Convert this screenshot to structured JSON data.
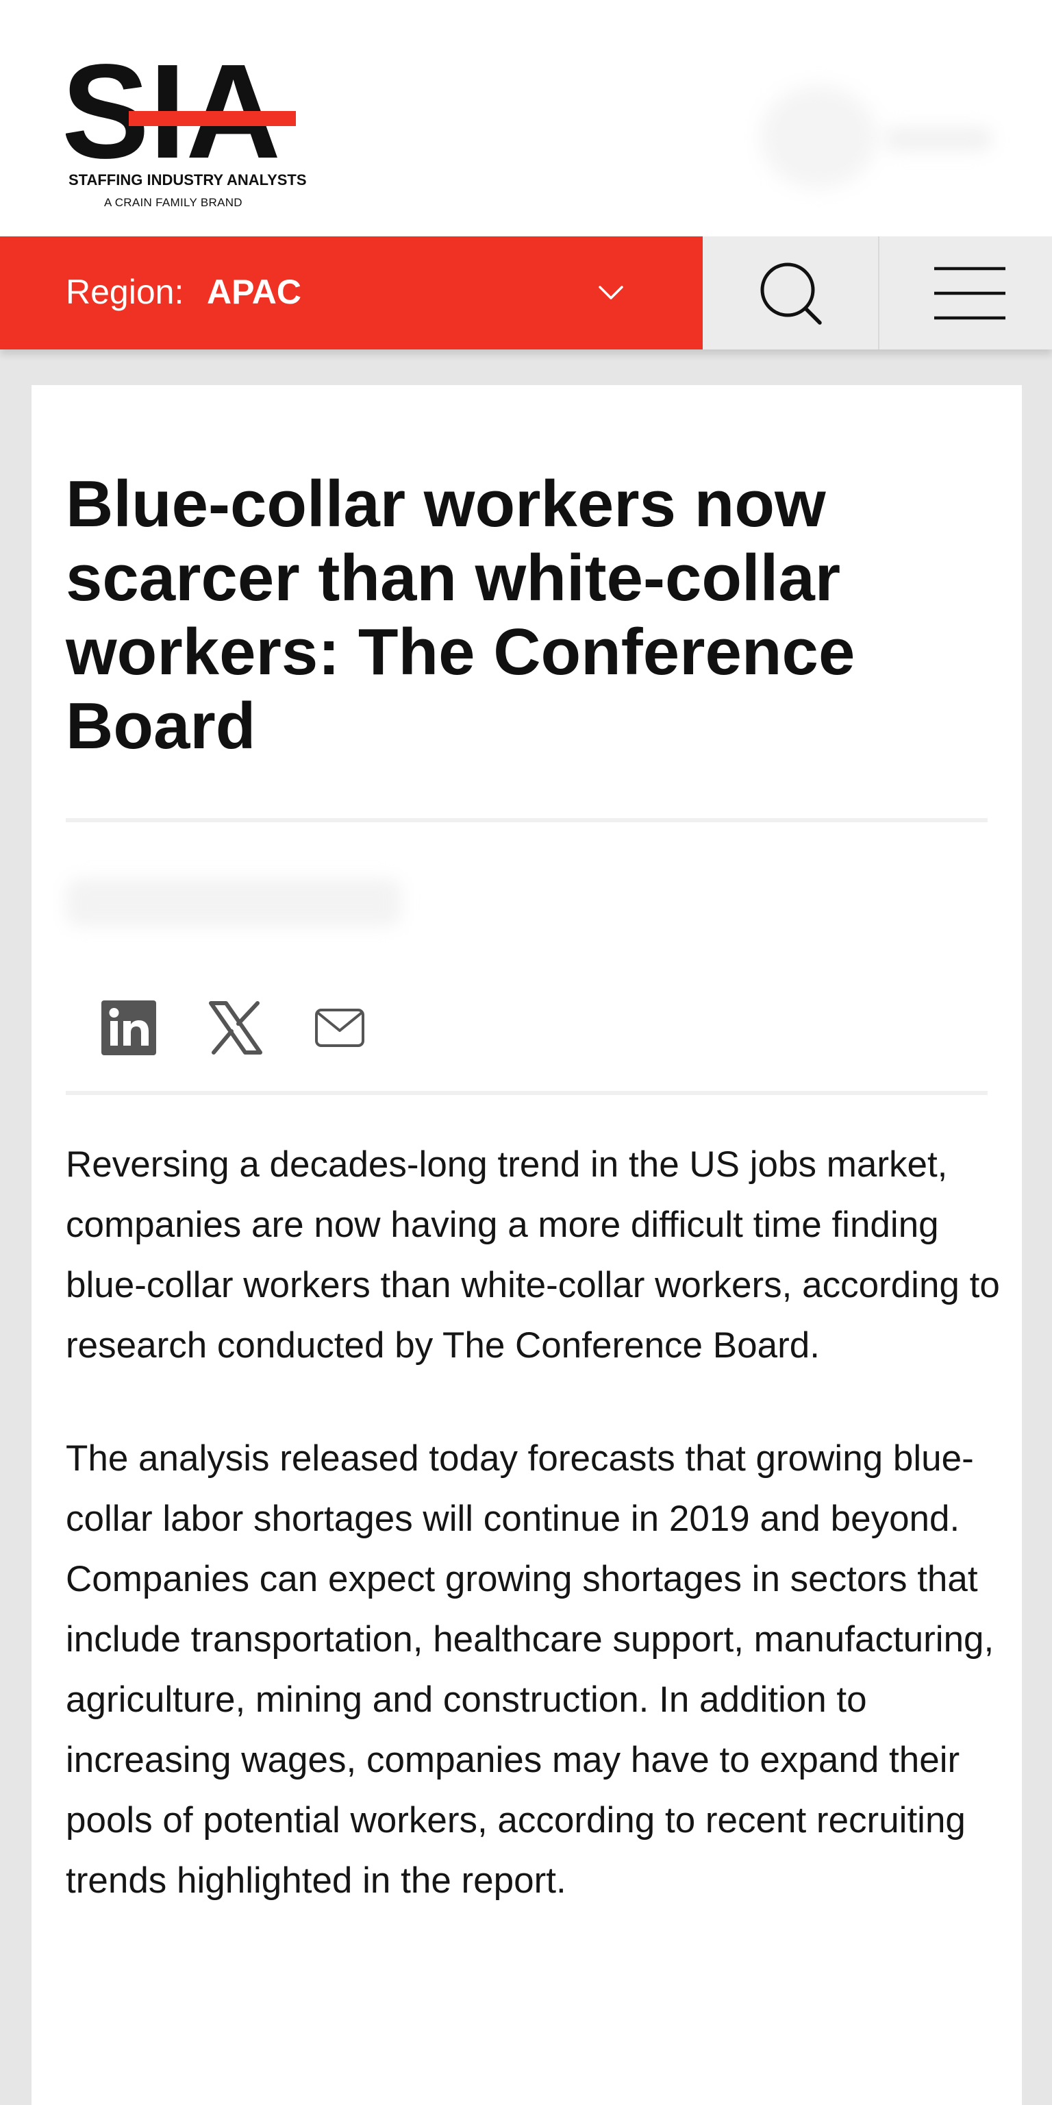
{
  "header": {
    "logo_text": "SIA",
    "logo_tagline": "STAFFING INDUSTRY ANALYSTS",
    "logo_subtag": "A CRAIN FAMILY BRAND"
  },
  "nav": {
    "region_label": "Region:",
    "region_value": "APAC",
    "icons": [
      "chevron-down-icon",
      "search-icon",
      "hamburger-menu-icon"
    ]
  },
  "article": {
    "headline": "Blue-collar workers now scarcer than white-collar workers: The Conference Board",
    "share_icons": [
      "linkedin-icon",
      "x-icon",
      "email-icon"
    ],
    "paragraphs": [
      "Reversing a decades-long trend in the US jobs market, companies are now having a more difficult time finding blue-collar workers than white-collar workers, according to research conducted by The Conference Board.",
      "The analysis released today forecasts that growing blue-collar labor shortages will continue in 2019 and beyond. Companies can expect growing shortages in sectors that include transportation, healthcare support, manufacturing, agriculture, mining and construction. In addition to increasing wages, companies may have to expand their pools of potential workers, according to recent recruiting trends highlighted in the report."
    ]
  },
  "colors": {
    "brand_red": "#ef3223",
    "nav_grey": "#ececec",
    "page_background": "#e6e6e6",
    "text": "#111111"
  }
}
